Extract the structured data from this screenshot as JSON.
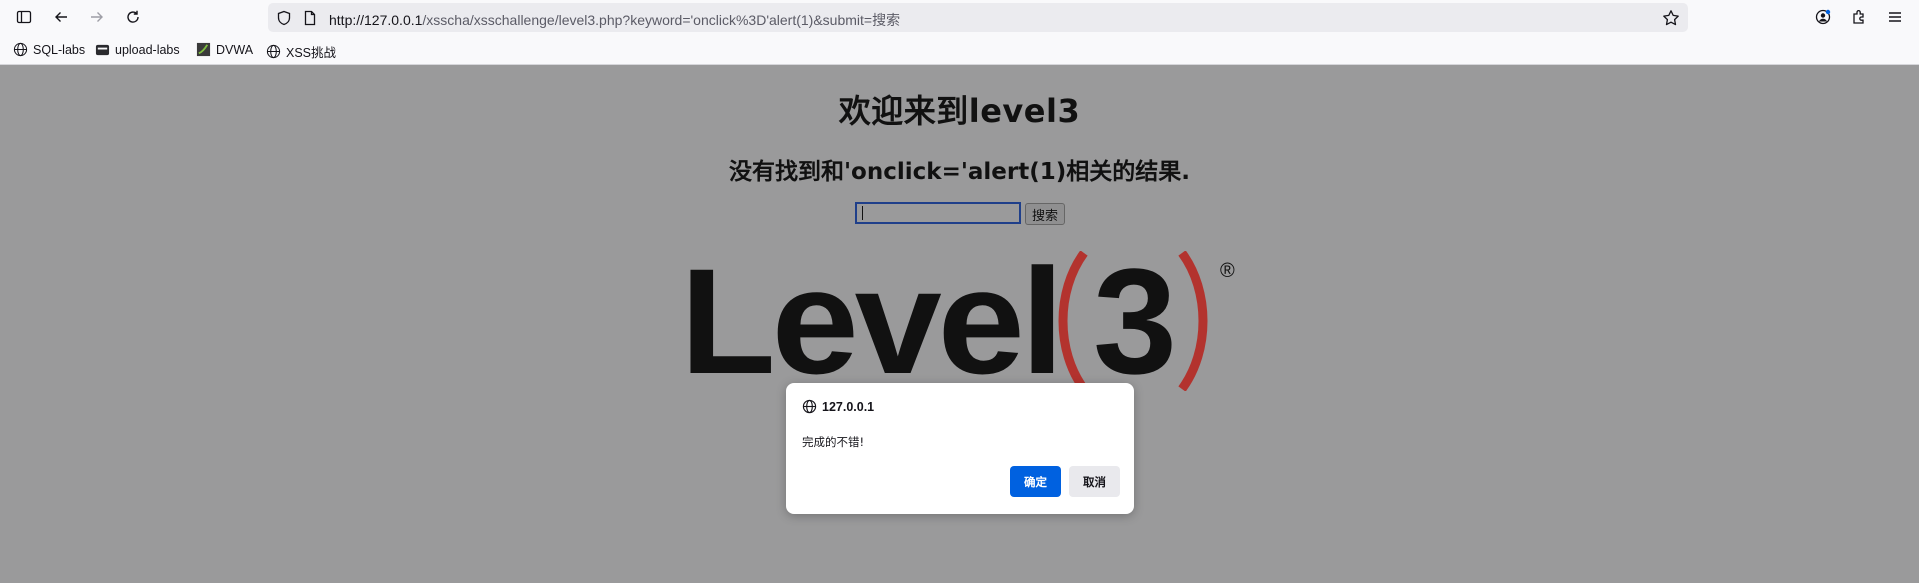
{
  "browser": {
    "url_host": "http://127.0.0.1",
    "url_path": "/xsscha/xsschallenge/level3.php?keyword='onclick%3D'alert(1)&submit=搜索",
    "bookmarks": [
      {
        "label": "SQL-labs",
        "icon": "globe-icon"
      },
      {
        "label": "upload-labs",
        "icon": "folder-icon"
      },
      {
        "label": "DVWA",
        "icon": "dvwa-icon"
      },
      {
        "label": "XSS挑战",
        "icon": "globe-icon"
      }
    ]
  },
  "page": {
    "title": "欢迎来到level3",
    "result_text": "没有找到和'onclick='alert(1)相关的结果.",
    "search_button_label": "搜索",
    "search_value": "",
    "logo_word": "Level",
    "logo_number": "3",
    "logo_mark": "®"
  },
  "dialog": {
    "origin": "127.0.0.1",
    "message": "完成的不错!",
    "ok_label": "确定",
    "cancel_label": "取消"
  },
  "colors": {
    "overlay": "#9a9a9b",
    "accent_blue": "#0061e0",
    "logo_red": "#b3332e",
    "logo_dark": "#111111"
  }
}
